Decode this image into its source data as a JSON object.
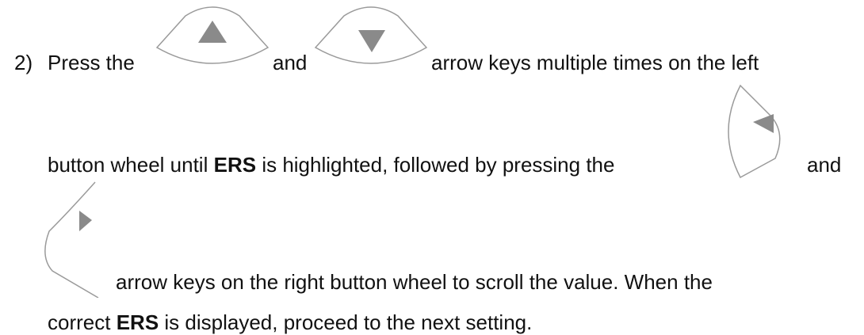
{
  "step": {
    "number": "2)",
    "line1": {
      "a": "Press the",
      "b": "and",
      "c": "arrow keys multiple times on the left"
    },
    "line2": {
      "a": "button wheel until",
      "ers1": "ERS",
      "b": "is highlighted, followed by pressing the",
      "c": "and"
    },
    "line3": {
      "a": "arrow keys on the right button wheel to scroll the value.  When the"
    },
    "line4": {
      "a": "correct",
      "ers2": "ERS",
      "b": "is displayed, proceed to the next setting."
    }
  },
  "icons": {
    "up": "up-arrow-key-icon",
    "down": "down-arrow-key-icon",
    "left": "left-arrow-key-icon",
    "right": "right-arrow-key-icon"
  },
  "colors": {
    "text": "#111111",
    "arrow": "#8a8a8a",
    "key_outline": "#9a9a9a"
  }
}
